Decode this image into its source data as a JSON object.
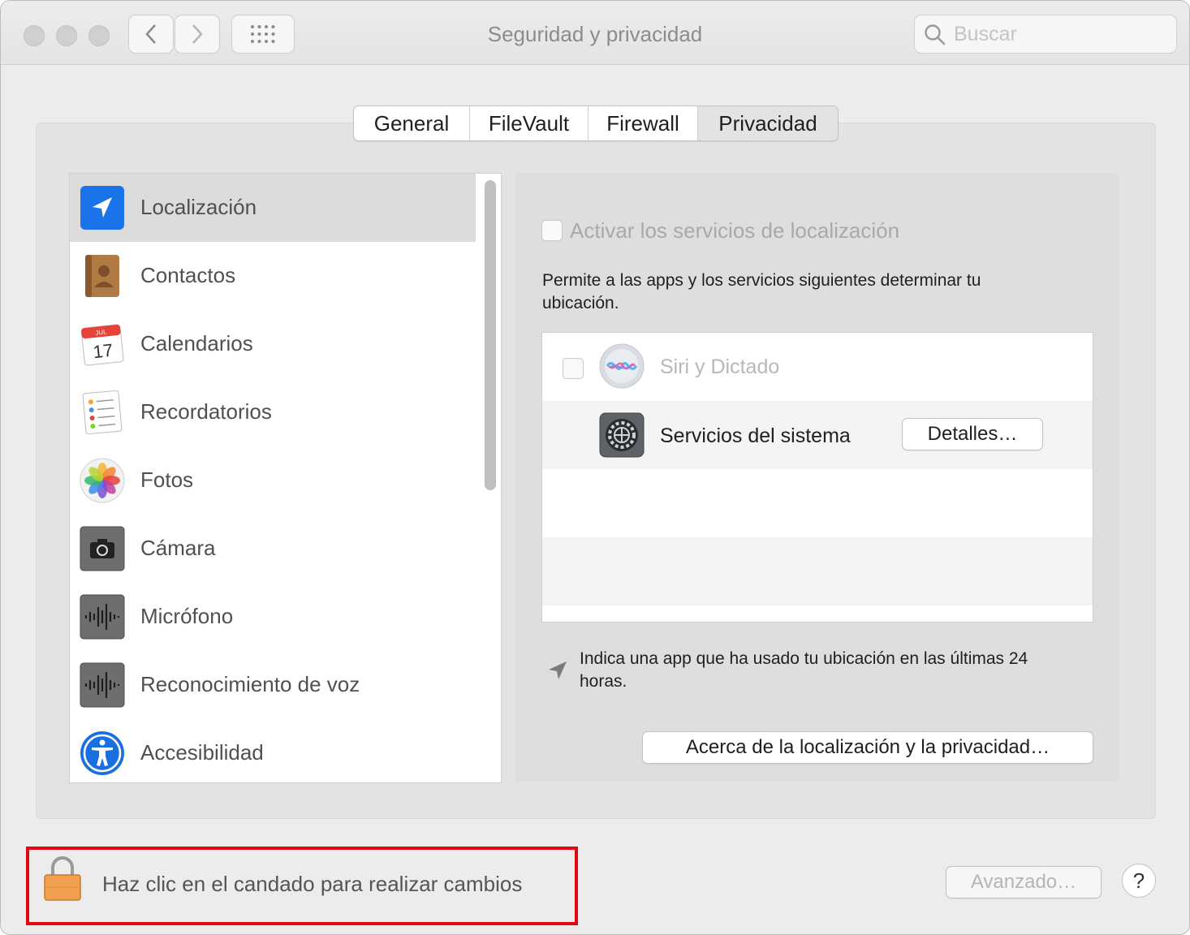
{
  "window": {
    "title": "Seguridad y privacidad"
  },
  "search": {
    "placeholder": "Buscar"
  },
  "tabs": [
    {
      "label": "General"
    },
    {
      "label": "FileVault"
    },
    {
      "label": "Firewall"
    },
    {
      "label": "Privacidad",
      "selected": true
    }
  ],
  "sidebar": {
    "items": [
      {
        "label": "Localización",
        "icon": "location-icon",
        "selected": true
      },
      {
        "label": "Contactos",
        "icon": "contacts-icon"
      },
      {
        "label": "Calendarios",
        "icon": "calendar-icon",
        "calendar_month": "JUL",
        "calendar_day": "17"
      },
      {
        "label": "Recordatorios",
        "icon": "reminders-icon"
      },
      {
        "label": "Fotos",
        "icon": "photos-icon"
      },
      {
        "label": "Cámara",
        "icon": "camera-icon"
      },
      {
        "label": "Micrófono",
        "icon": "microphone-icon"
      },
      {
        "label": "Reconocimiento de voz",
        "icon": "speech-recognition-icon"
      },
      {
        "label": "Accesibilidad",
        "icon": "accessibility-icon"
      }
    ]
  },
  "location": {
    "enable_label": "Activar los servicios de localización",
    "enable_checked": false,
    "description": "Permite a las apps y los servicios siguientes determinar tu ubicación.",
    "apps": [
      {
        "name": "Siri y Dictado",
        "icon": "siri-icon",
        "checked": false,
        "disabled": true
      },
      {
        "name": "Servicios del sistema",
        "icon": "system-preferences-icon",
        "details_button": "Detalles…"
      }
    ],
    "note": "Indica una app que ha usado tu ubicación en las últimas 24 horas.",
    "about_button": "Acerca de la localización y la privacidad…"
  },
  "footer": {
    "lock_text": "Haz clic en el candado para realizar cambios",
    "advanced_button": "Avanzado…",
    "help_button": "?"
  },
  "colors": {
    "window_bg": "#ececec",
    "highlight_box": "#e30613",
    "location_blue": "#1a73e8",
    "lock_orange": "#f0a050"
  }
}
